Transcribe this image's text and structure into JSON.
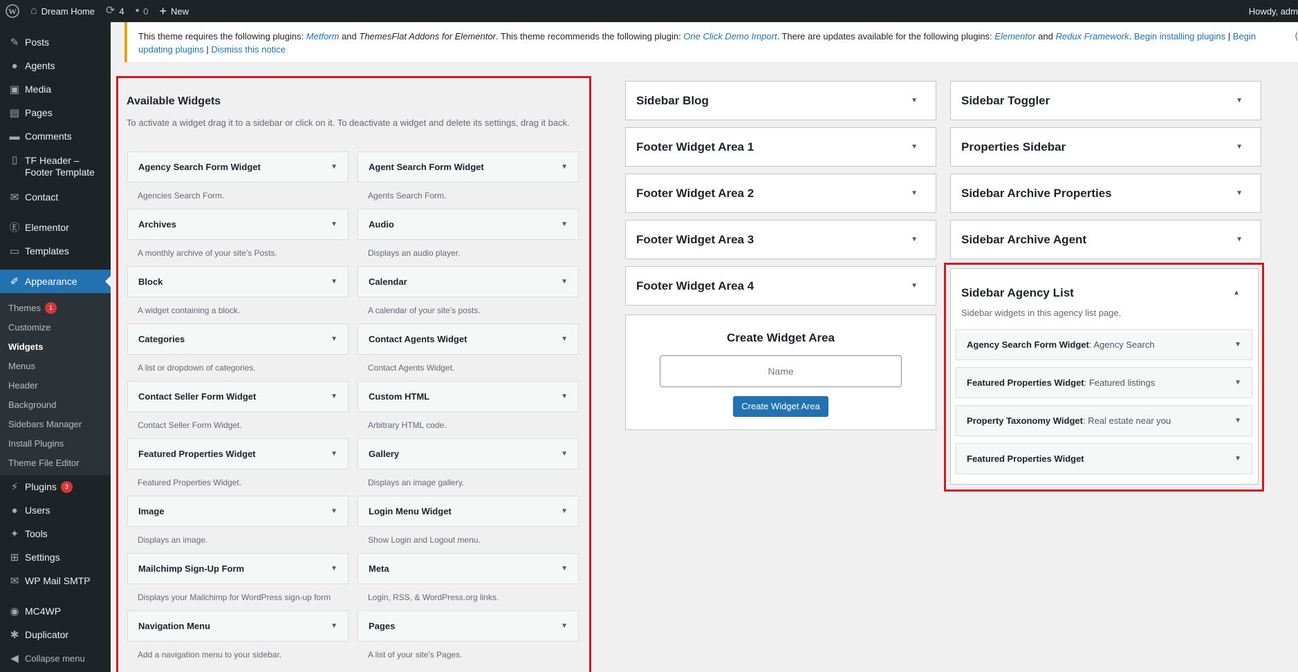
{
  "adminbar": {
    "site_name": "Dream Home",
    "updates_count": "4",
    "comments_count": "0",
    "new_label": "New",
    "howdy": "Howdy, adm"
  },
  "menu": {
    "posts": "Posts",
    "agents": "Agents",
    "media": "Media",
    "pages": "Pages",
    "comments": "Comments",
    "tf_header": "TF Header –",
    "tf_header2": "Footer Template",
    "contact": "Contact",
    "elementor": "Elementor",
    "templates": "Templates",
    "appearance": "Appearance",
    "sub": {
      "themes": "Themes",
      "themes_badge": "1",
      "customize": "Customize",
      "widgets": "Widgets",
      "menus": "Menus",
      "header": "Header",
      "background": "Background",
      "sidebars_manager": "Sidebars Manager",
      "install_plugins": "Install Plugins",
      "theme_file_editor": "Theme File Editor"
    },
    "plugins": "Plugins",
    "plugins_badge": "3",
    "users": "Users",
    "tools": "Tools",
    "settings": "Settings",
    "wp_mail_smtp": "WP Mail SMTP",
    "mc4wp": "MC4WP",
    "duplicator": "Duplicator",
    "collapse": "Collapse menu"
  },
  "notice": {
    "t1": "This theme requires the following plugins: ",
    "l1": "Metform",
    "t2": " and ",
    "i1": "ThemesFlat Addons for Elementor",
    "t3": ". This theme recommends the following plugin: ",
    "l2": "One Click Demo Import",
    "t4": ". There are updates available for the following plugins: ",
    "l3": "Elementor",
    "t5": " and ",
    "l4": "Redux Framework",
    "t6": ". ",
    "a1": "Begin installing plugins",
    "sep1": " | ",
    "a2": "Begin updating plugins",
    "sep2": " | ",
    "a3": "Dismiss this notice"
  },
  "available": {
    "title": "Available Widgets",
    "description": "To activate a widget drag it to a sidebar or click on it. To deactivate a widget and delete its settings, drag it back.",
    "widgets": [
      {
        "name": "Agency Search Form Widget",
        "desc": "Agencies Search Form."
      },
      {
        "name": "Agent Search Form Widget",
        "desc": "Agents Search Form."
      },
      {
        "name": "Archives",
        "desc": "A monthly archive of your site’s Posts."
      },
      {
        "name": "Audio",
        "desc": "Displays an audio player."
      },
      {
        "name": "Block",
        "desc": "A widget containing a block."
      },
      {
        "name": "Calendar",
        "desc": "A calendar of your site’s posts."
      },
      {
        "name": "Categories",
        "desc": "A list or dropdown of categories."
      },
      {
        "name": "Contact Agents Widget",
        "desc": "Contact Agents Widget."
      },
      {
        "name": "Contact Seller Form Widget",
        "desc": "Contact Seller Form Widget."
      },
      {
        "name": "Custom HTML",
        "desc": "Arbitrary HTML code."
      },
      {
        "name": "Featured Properties Widget",
        "desc": "Featured Properties Widget."
      },
      {
        "name": "Gallery",
        "desc": "Displays an image gallery."
      },
      {
        "name": "Image",
        "desc": "Displays an image."
      },
      {
        "name": "Login Menu Widget",
        "desc": "Show Login and Logout menu."
      },
      {
        "name": "Mailchimp Sign-Up Form",
        "desc": "Displays your Mailchimp for WordPress sign-up form"
      },
      {
        "name": "Meta",
        "desc": "Login, RSS, & WordPress.org links."
      },
      {
        "name": "Navigation Menu",
        "desc": "Add a navigation menu to your sidebar."
      },
      {
        "name": "Pages",
        "desc": "A list of your site’s Pages."
      }
    ]
  },
  "sidebars_col1": [
    "Sidebar Blog",
    "Footer Widget Area 1",
    "Footer Widget Area 2",
    "Footer Widget Area 3",
    "Footer Widget Area 4"
  ],
  "sidebars_col2": [
    "Sidebar Toggler",
    "Properties Sidebar",
    "Sidebar Archive Properties",
    "Sidebar Archive Agent"
  ],
  "create": {
    "title": "Create Widget Area",
    "placeholder": "Name",
    "button": "Create Widget Area"
  },
  "agency_sidebar": {
    "title": "Sidebar Agency List",
    "description": "Sidebar widgets in this agency list page.",
    "widgets": [
      {
        "title": "Agency Search Form Widget",
        "sub": ": Agency Search"
      },
      {
        "title": "Featured Properties Widget",
        "sub": ": Featured listings"
      },
      {
        "title": "Property Taxonomy Widget",
        "sub": ": Real estate near you"
      },
      {
        "title": "Featured Properties Widget",
        "sub": ""
      }
    ]
  },
  "stray_char": "("
}
